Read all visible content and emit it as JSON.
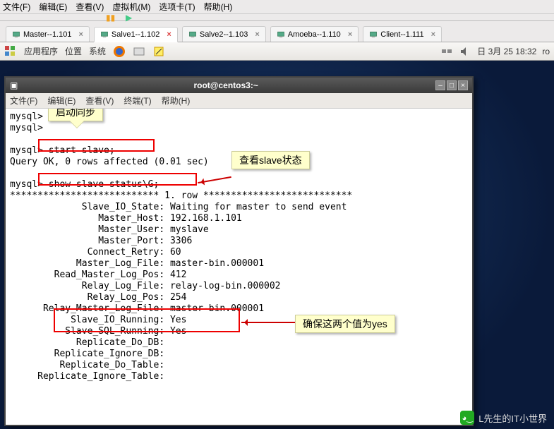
{
  "host_menu": {
    "file": "文件(F)",
    "edit": "编辑(E)",
    "view": "查看(V)",
    "vm": "虚拟机(M)",
    "tabs": "选项卡(T)",
    "help": "帮助(H)"
  },
  "tabs": [
    {
      "label": "Master--1.101",
      "active": false
    },
    {
      "label": "Salve1--1.102",
      "active": true
    },
    {
      "label": "Salve2--1.103",
      "active": false
    },
    {
      "label": "Amoeba--1.110",
      "active": false
    },
    {
      "label": "Client--1.111",
      "active": false
    }
  ],
  "gnome": {
    "apps": "应用程序",
    "places": "位置",
    "system": "系统",
    "date": "日 3月 25 18:32",
    "user": "ro"
  },
  "term": {
    "title": "root@centos3:~",
    "menu": {
      "file": "文件(F)",
      "edit": "编辑(E)",
      "view": "查看(V)",
      "term": "终端(T)",
      "help": "帮助(H)"
    }
  },
  "term_lines": [
    "mysql>",
    "mysql>",
    "",
    "mysql> start slave;",
    "Query OK, 0 rows affected (0.01 sec)",
    "",
    "mysql> show slave status\\G;",
    "*************************** 1. row ***************************",
    "             Slave_IO_State: Waiting for master to send event",
    "                Master_Host: 192.168.1.101",
    "                Master_User: myslave",
    "                Master_Port: 3306",
    "              Connect_Retry: 60",
    "            Master_Log_File: master-bin.000001",
    "        Read_Master_Log_Pos: 412",
    "             Relay_Log_File: relay-log-bin.000002",
    "              Relay_Log_Pos: 254",
    "      Relay_Master_Log_File: master-bin.000001",
    "           Slave_IO_Running: Yes",
    "          Slave_SQL_Running: Yes",
    "            Replicate_Do_DB:",
    "        Replicate_Ignore_DB:",
    "         Replicate_Do_Table:",
    "     Replicate_Ignore_Table:"
  ],
  "callouts": {
    "c1": "启动同步",
    "c2": "查看slave状态",
    "c3": "确保这两个值为yes"
  },
  "watermark": "L先生的IT小世界"
}
